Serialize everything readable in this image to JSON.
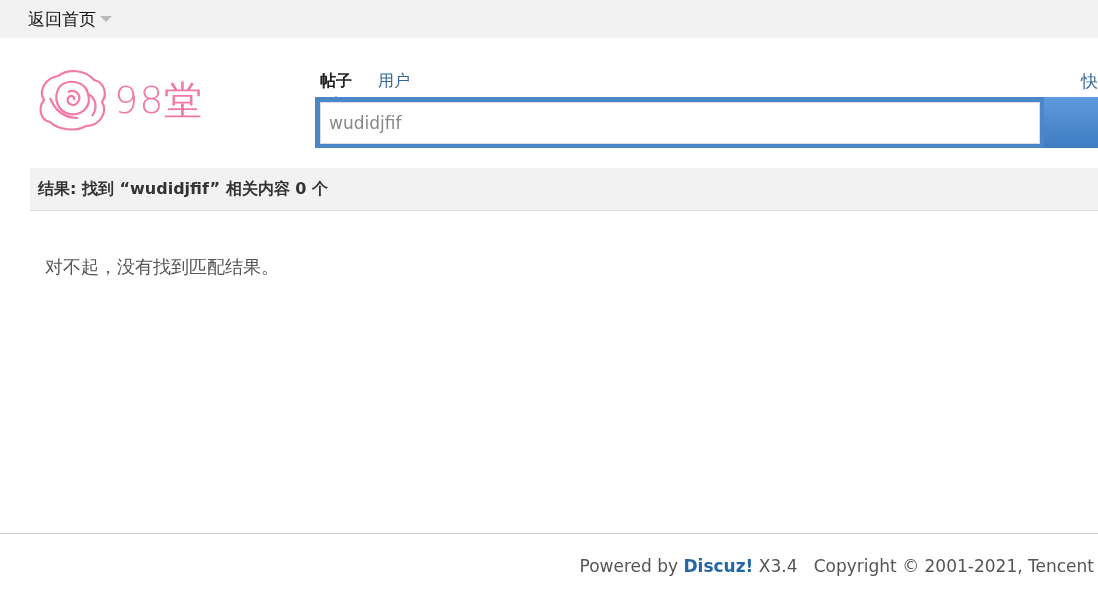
{
  "topbar": {
    "home_link": "返回首页"
  },
  "logo": {
    "text": "98堂"
  },
  "search": {
    "tabs": [
      {
        "label": "帖子",
        "selected": true
      },
      {
        "label": "用户",
        "selected": false
      }
    ],
    "quick_link": "快",
    "value": "wudidjfif"
  },
  "results": {
    "header": "结果: 找到 “wudidjfif” 相关内容 0 个",
    "message": "对不起，没有找到匹配结果。"
  },
  "footer": {
    "powered": "Powered by",
    "link": "Discuz!",
    "version": "X3.4",
    "copyright": "Copyright © 2001-2021, Tencent"
  }
}
